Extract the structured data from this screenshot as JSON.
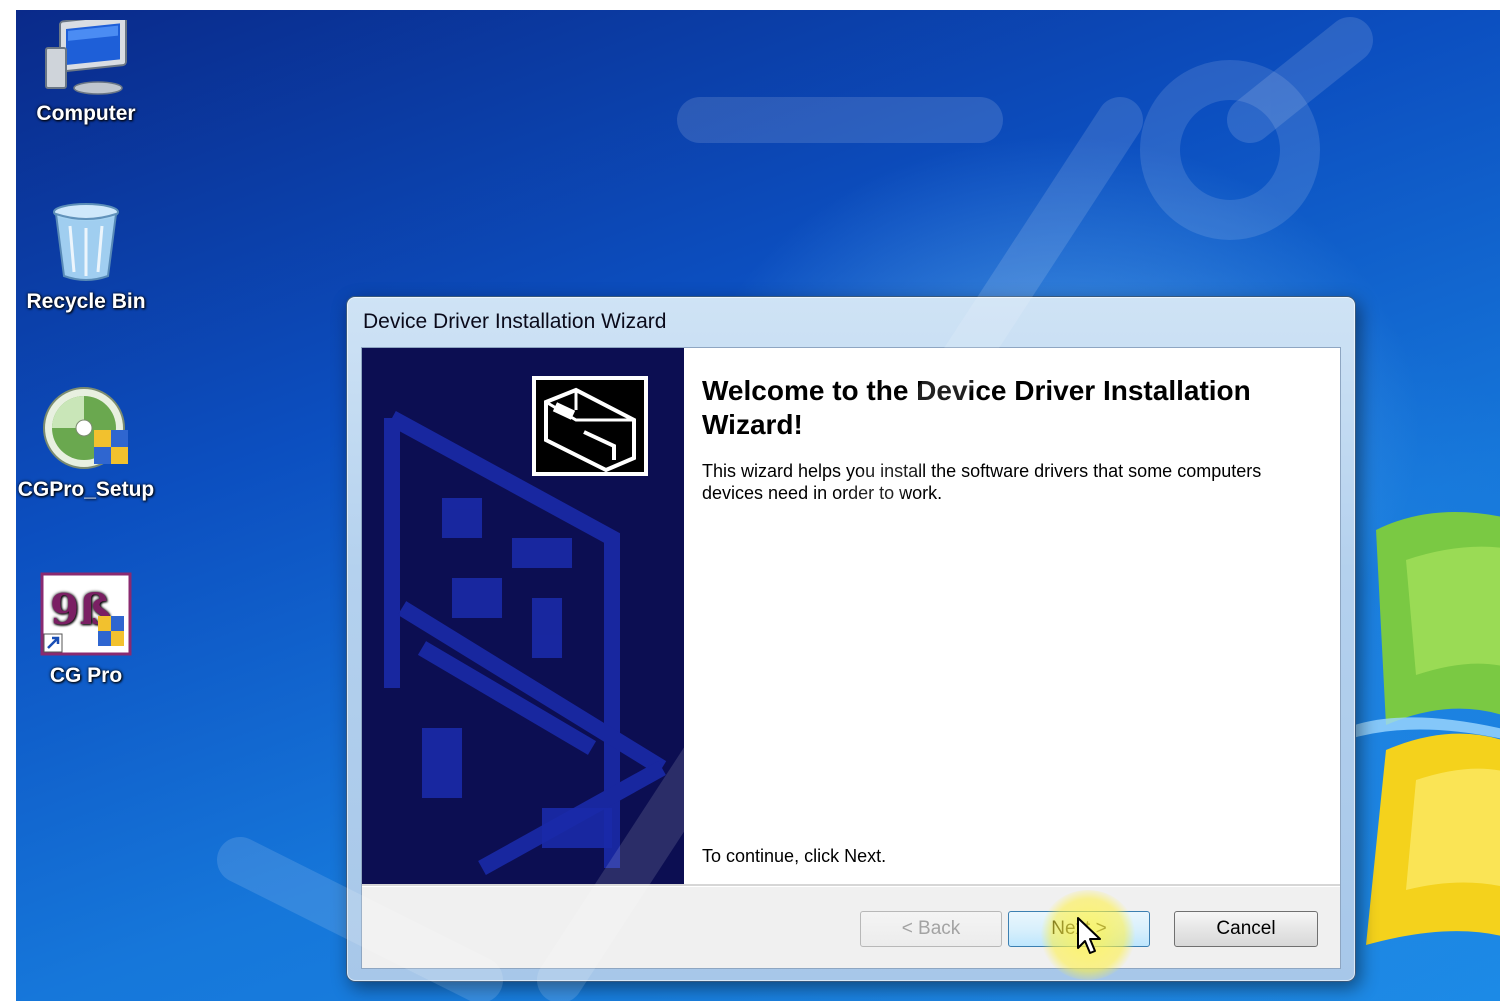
{
  "desktop": {
    "icons": [
      {
        "label": "Computer",
        "icon": "computer-icon"
      },
      {
        "label": "Recycle Bin",
        "icon": "recycle-bin-icon"
      },
      {
        "label": "CGPro_Setup",
        "icon": "setup-disc-icon"
      },
      {
        "label": "CG Pro",
        "icon": "cg-pro-icon",
        "glyph": "9ß"
      }
    ]
  },
  "wizard": {
    "title": "Device Driver Installation Wizard",
    "heading": "Welcome to the Device Driver Installation Wizard!",
    "description": "This wizard helps you install the software drivers that some computers devices need in order to work.",
    "continue_text": "To continue, click Next.",
    "buttons": {
      "back": "< Back",
      "next": "Next >",
      "cancel": "Cancel"
    },
    "banner_icon": "hardware-device-icon"
  },
  "colors": {
    "banner": "#0c0e52",
    "desktop_top": "#0a2a8a",
    "desktop_bottom": "#1c8ae6",
    "cursor_highlight": "#fff03c"
  }
}
